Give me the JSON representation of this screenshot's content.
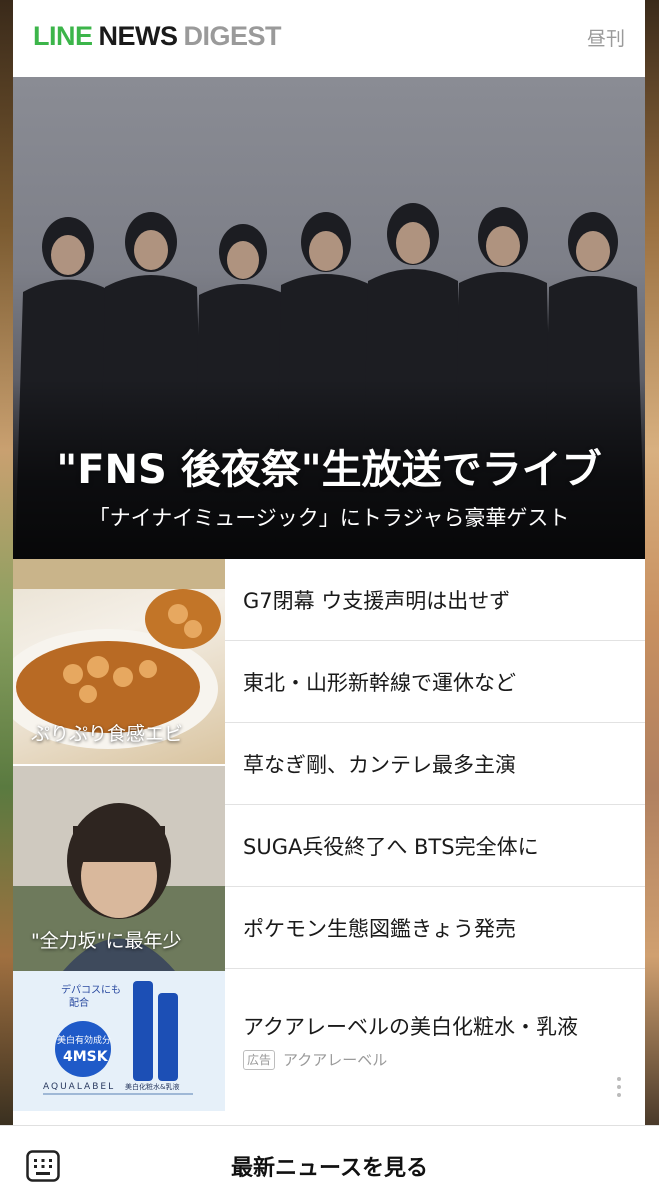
{
  "header": {
    "logo_line": "LINE",
    "logo_news": "NEWS",
    "logo_digest": "DIGEST",
    "edition": "昼刊"
  },
  "hero": {
    "title": "\"FNS 後夜祭\"生放送でライブ",
    "subtitle": "「ナイナイミュージック」にトラジャら豪華ゲスト"
  },
  "thumbnails": [
    {
      "caption": "ぷりぷり食感エビ"
    },
    {
      "caption": "\"全力坂\"に最年少"
    }
  ],
  "headlines": [
    "G7閉幕 ウ支援声明は出せず",
    "東北・山形新幹線で運休など",
    "草なぎ剛、カンテレ最多主演",
    "SUGA兵役終了へ BTS完全体に",
    "ポケモン生態図鑑きょう発売"
  ],
  "ad": {
    "title": "アクアレーベルの美白化粧水・乳液",
    "badge": "広告",
    "advertiser": "アクアレーベル",
    "image_text": {
      "tag1": "デパコスにも",
      "tag2": "配合",
      "ingredient_label": "美白有効成分",
      "ingredient": "4MSK",
      "brand": "AQUALABEL",
      "product": "美白化粧水&乳液"
    }
  },
  "footer": {
    "label": "最新ニュースを見る"
  },
  "colors": {
    "line_green": "#3cb54a",
    "text_dark": "#1a1a1a",
    "text_gray": "#9a9a9a"
  }
}
